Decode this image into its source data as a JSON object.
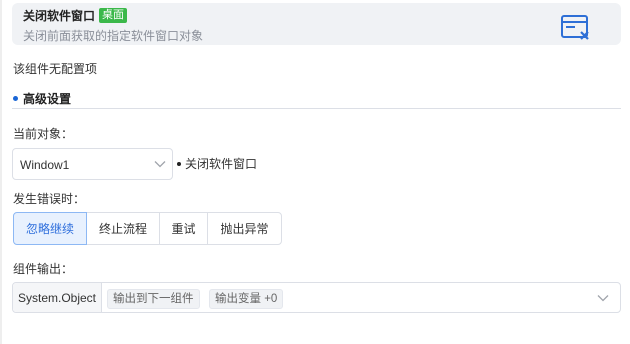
{
  "header": {
    "title": "关闭软件窗口",
    "badge": "桌面",
    "subtitle": "关闭前面获取的指定软件窗口对象",
    "icon": "close-window-icon"
  },
  "config": {
    "no_config_text": "该组件无配置项"
  },
  "advanced": {
    "section_title": "高级设置",
    "target_label": "当前对象：",
    "target_value": "Window1",
    "target_description": "关闭软件窗口",
    "on_error_label": "发生错误时：",
    "on_error_options": [
      "忽略继续",
      "终止流程",
      "重试",
      "抛出异常"
    ],
    "on_error_selected": "忽略继续",
    "output_label": "组件输出：",
    "output_type": "System.Object",
    "output_tags": [
      "输出到下一组件",
      "输出变量 +0"
    ]
  },
  "colors": {
    "accent": "#1a66d6",
    "badge_green": "#3bb84a",
    "active_bg": "#e8f1fe"
  }
}
